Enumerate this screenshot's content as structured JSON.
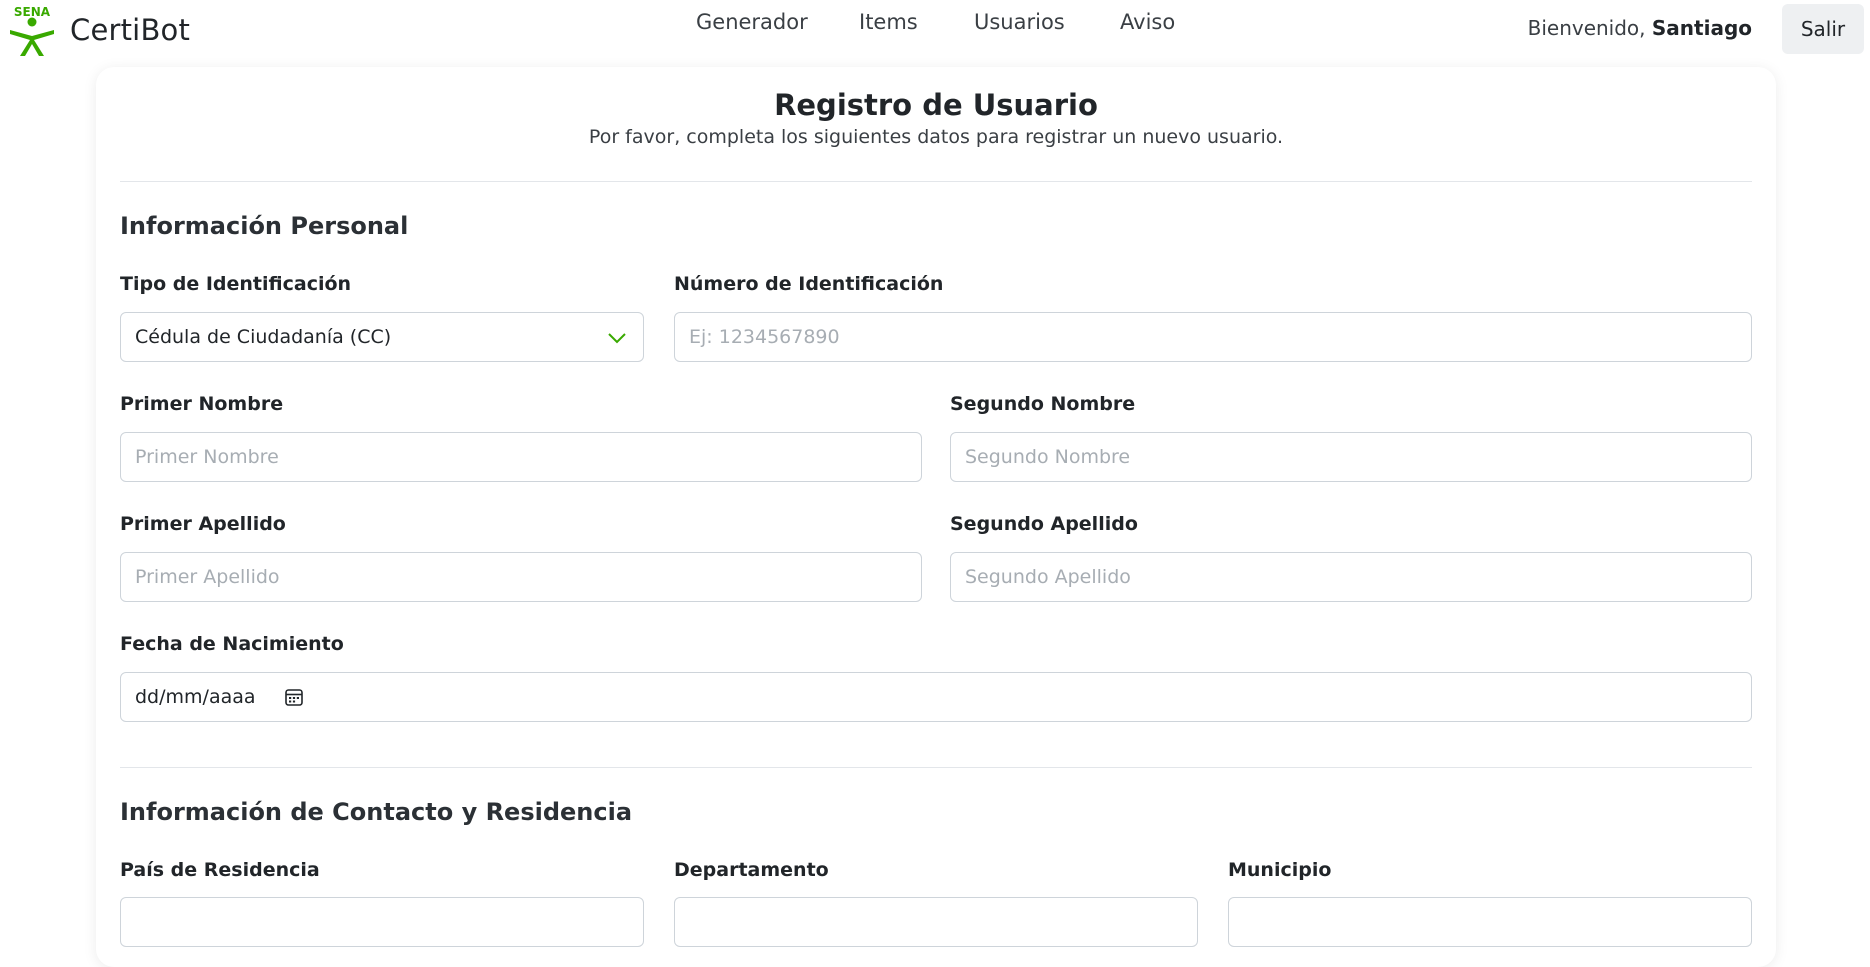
{
  "navbar": {
    "brand_logo_text": "SENA",
    "brand_name": "CertiBot",
    "links": [
      "Generador",
      "Items",
      "Usuarios",
      "Aviso"
    ],
    "welcome_prefix": "Bienvenido, ",
    "user_name": "Santiago",
    "logout_label": "Salir"
  },
  "form": {
    "title": "Registro de Usuario",
    "subtitle": "Por favor, completa los siguientes datos para registrar un nuevo usuario.",
    "personal": {
      "section_title": "Información Personal",
      "id_type": {
        "label": "Tipo de Identificación",
        "value": "Cédula de Ciudadanía (CC)"
      },
      "id_number": {
        "label": "Número de Identificación",
        "placeholder": "Ej: 1234567890"
      },
      "first_name": {
        "label": "Primer Nombre",
        "placeholder": "Primer Nombre"
      },
      "second_name": {
        "label": "Segundo Nombre",
        "placeholder": "Segundo Nombre"
      },
      "first_surname": {
        "label": "Primer Apellido",
        "placeholder": "Primer Apellido"
      },
      "second_surname": {
        "label": "Segundo Apellido",
        "placeholder": "Segundo Apellido"
      },
      "birth_date": {
        "label": "Fecha de Nacimiento",
        "value": "dd/mm/aaaa"
      }
    },
    "contact": {
      "section_title": "Información de Contacto y Residencia",
      "country": {
        "label": "País de Residencia"
      },
      "department": {
        "label": "Departamento"
      },
      "municipality": {
        "label": "Municipio"
      }
    }
  },
  "colors": {
    "brand_green": "#39a900",
    "text_dark": "#212529",
    "border": "#ced4da",
    "placeholder": "#a7adb3"
  },
  "icons": [
    "sena-logo-icon",
    "chevron-down-icon",
    "calendar-icon"
  ]
}
